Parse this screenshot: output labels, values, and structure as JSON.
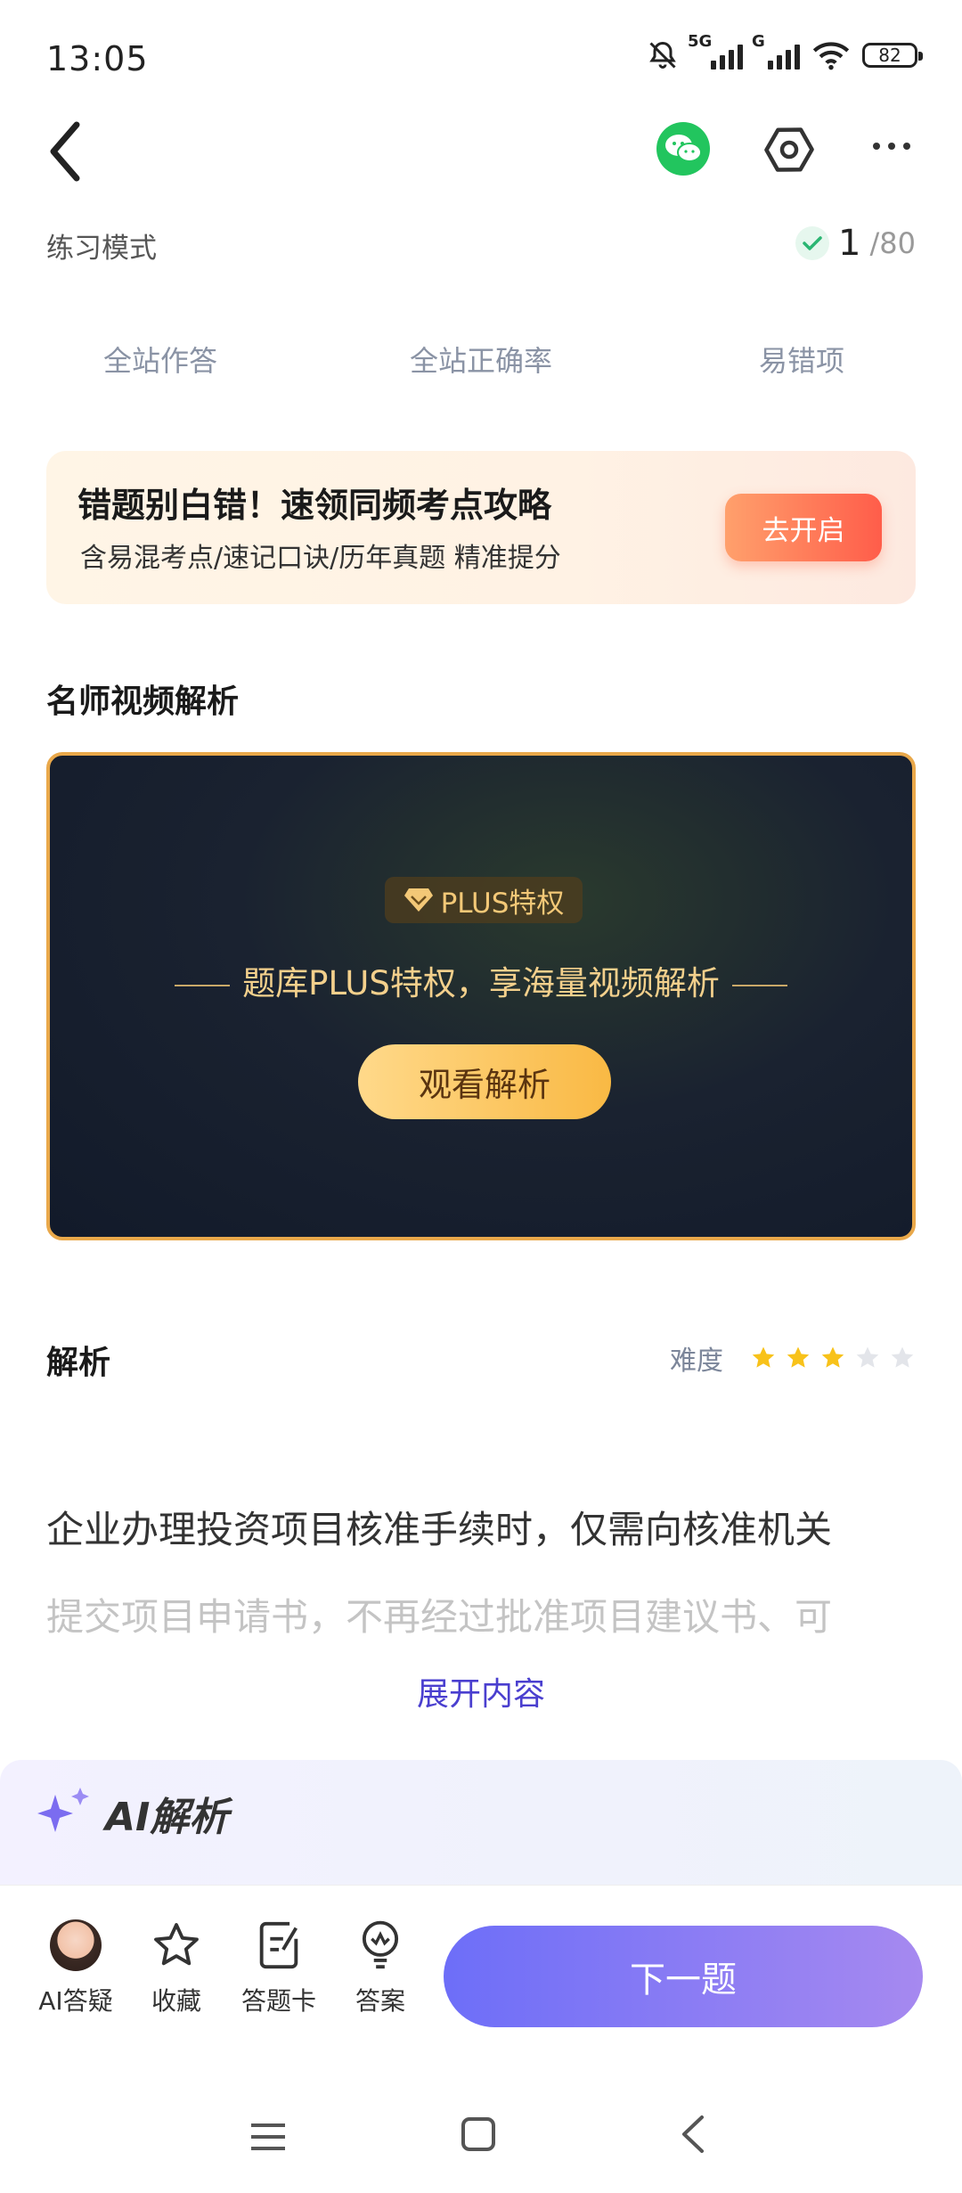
{
  "status_bar": {
    "time": "13:05",
    "battery": "82",
    "signal1_tag": "5G",
    "signal2_tag": "G"
  },
  "header": {
    "icons": [
      "back-icon",
      "wechat-icon",
      "settings-icon",
      "more-icon"
    ]
  },
  "mode": {
    "label": "练习模式",
    "current": "1",
    "total": "/80"
  },
  "stats": {
    "items": [
      "全站作答",
      "全站正确率",
      "易错项"
    ]
  },
  "promo": {
    "title": "错题别白错！速领同频考点攻略",
    "subtitle": "含易混考点/速记口诀/历年真题 精准提分",
    "button": "去开启"
  },
  "video": {
    "section_title": "名师视频解析",
    "badge": "PLUS特权",
    "text": "题库PLUS特权，享海量视频解析",
    "button": "观看解析"
  },
  "analysis": {
    "title": "解析",
    "difficulty_label": "难度",
    "difficulty_stars": 3,
    "difficulty_max": 5,
    "line1": "企业办理投资项目核准手续时，仅需向核准机关",
    "line2": "提交项目申请书，不再经过批准项目建议书、可",
    "expand": "展开内容"
  },
  "ai": {
    "label": "AI解析"
  },
  "toolbar": {
    "ai_qa": "AI答疑",
    "favorite": "收藏",
    "answer_card": "答题卡",
    "answer": "答案",
    "next": "下一题"
  },
  "colors": {
    "accent": "#6d6ef8",
    "star": "#f8c21a",
    "promo_button": "#ff5d4a",
    "link": "#4a3fcf"
  }
}
